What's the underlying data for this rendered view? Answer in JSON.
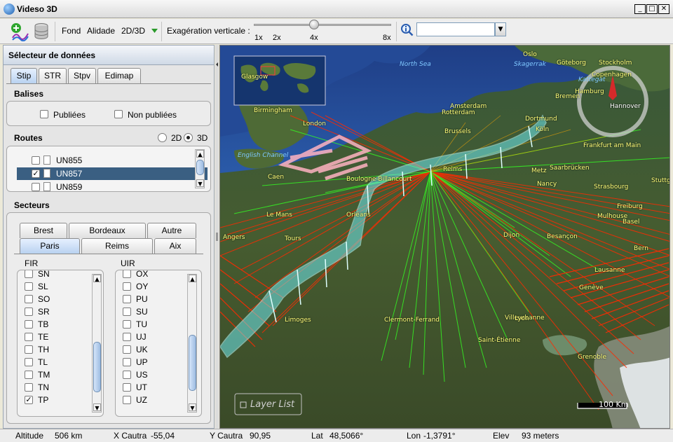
{
  "window": {
    "title": "Videso 3D",
    "buttons": [
      "_",
      "□",
      "✕"
    ]
  },
  "toolbar": {
    "fond_label": "Fond",
    "alidade_label": "Alidade",
    "view_mode_label": "2D/3D",
    "exaggeration_label": "Exagération verticale :",
    "exaggeration_ticks": [
      "1x",
      "2x",
      "4x",
      "8x"
    ],
    "exaggeration_value": "4x",
    "search_value": ""
  },
  "sidebar": {
    "title": "Sélecteur de données",
    "tabs": [
      "Stip",
      "STR",
      "Stpv",
      "Edimap"
    ],
    "active_tab": "Stip",
    "balises": {
      "title": "Balises",
      "options": [
        {
          "label": "Publiées",
          "checked": false
        },
        {
          "label": "Non publiées",
          "checked": false
        }
      ]
    },
    "routes": {
      "title": "Routes",
      "radio_2d": "2D",
      "radio_3d": "3D",
      "selected_mode": "3D",
      "items": [
        {
          "label": "UN855",
          "checked": false,
          "selected": false
        },
        {
          "label": "UN857",
          "checked": true,
          "selected": true
        },
        {
          "label": "UN859",
          "checked": false,
          "selected": false
        }
      ]
    },
    "secteurs": {
      "title": "Secteurs",
      "tabs_row1": [
        "Brest",
        "Bordeaux",
        "Autre"
      ],
      "tabs_row2": [
        "Paris",
        "Reims",
        "Aix"
      ],
      "active_tab": "Paris",
      "fir": {
        "title": "FIR",
        "items": [
          {
            "label": "SN",
            "checked": false
          },
          {
            "label": "SL",
            "checked": false
          },
          {
            "label": "SO",
            "checked": false
          },
          {
            "label": "SR",
            "checked": false
          },
          {
            "label": "TB",
            "checked": false
          },
          {
            "label": "TE",
            "checked": false
          },
          {
            "label": "TH",
            "checked": false
          },
          {
            "label": "TL",
            "checked": false
          },
          {
            "label": "TM",
            "checked": false
          },
          {
            "label": "TN",
            "checked": false
          },
          {
            "label": "TP",
            "checked": true
          }
        ]
      },
      "uir": {
        "title": "UIR",
        "items": [
          {
            "label": "OX",
            "checked": false
          },
          {
            "label": "OY",
            "checked": false
          },
          {
            "label": "PU",
            "checked": false
          },
          {
            "label": "SU",
            "checked": false
          },
          {
            "label": "TU",
            "checked": false
          },
          {
            "label": "UJ",
            "checked": false
          },
          {
            "label": "UK",
            "checked": false
          },
          {
            "label": "UP",
            "checked": false
          },
          {
            "label": "US",
            "checked": false
          },
          {
            "label": "UT",
            "checked": false
          },
          {
            "label": "UZ",
            "checked": false
          }
        ]
      }
    }
  },
  "map": {
    "layer_list_label": "Layer List",
    "scale_label": "100 Km",
    "compass_label": "N",
    "water_labels": [
      "North Sea",
      "Skagerrak",
      "Kattegat",
      "English Channel"
    ],
    "cities": [
      "Oslo",
      "Göteborg",
      "Stockholm",
      "Copenhagen",
      "Glasgow",
      "Hamburg",
      "Bremen",
      "Hannover",
      "Birmingham",
      "Amsterdam",
      "Rotterdam",
      "Dortmund",
      "London",
      "Brussels",
      "Köln",
      "Frankfurt am Main",
      "Caen",
      "Reims",
      "Metz",
      "Saarbrücken",
      "Boulogne-Billancourt",
      "Nancy",
      "Strasbourg",
      "Stuttgart",
      "Le Mans",
      "Orléans",
      "Freiburg",
      "Mulhouse",
      "Basel",
      "Angers",
      "Tours",
      "Dijon",
      "Besançon",
      "Bern",
      "Lausanne",
      "Genève",
      "Limoges",
      "Clermont-Ferrand",
      "Villeurbanne",
      "Lyon",
      "Saint-Étienne",
      "Grenoble"
    ],
    "colors": {
      "route": "#6ee8ee",
      "tracks_red": "#ff2a00",
      "tracks_green": "#33ff22",
      "tma": "#ffb3c1"
    }
  },
  "status": {
    "altitude_label": "Altitude",
    "altitude_value": "506 km",
    "xcautra_label": "X Cautra",
    "xcautra_value": "-55,04",
    "ycautra_label": "Y Cautra",
    "ycautra_value": "90,95",
    "lat_label": "Lat",
    "lat_value": "48,5066°",
    "lon_label": "Lon",
    "lon_value": "-1,3791°",
    "elev_label": "Elev",
    "elev_value": "93 meters"
  }
}
